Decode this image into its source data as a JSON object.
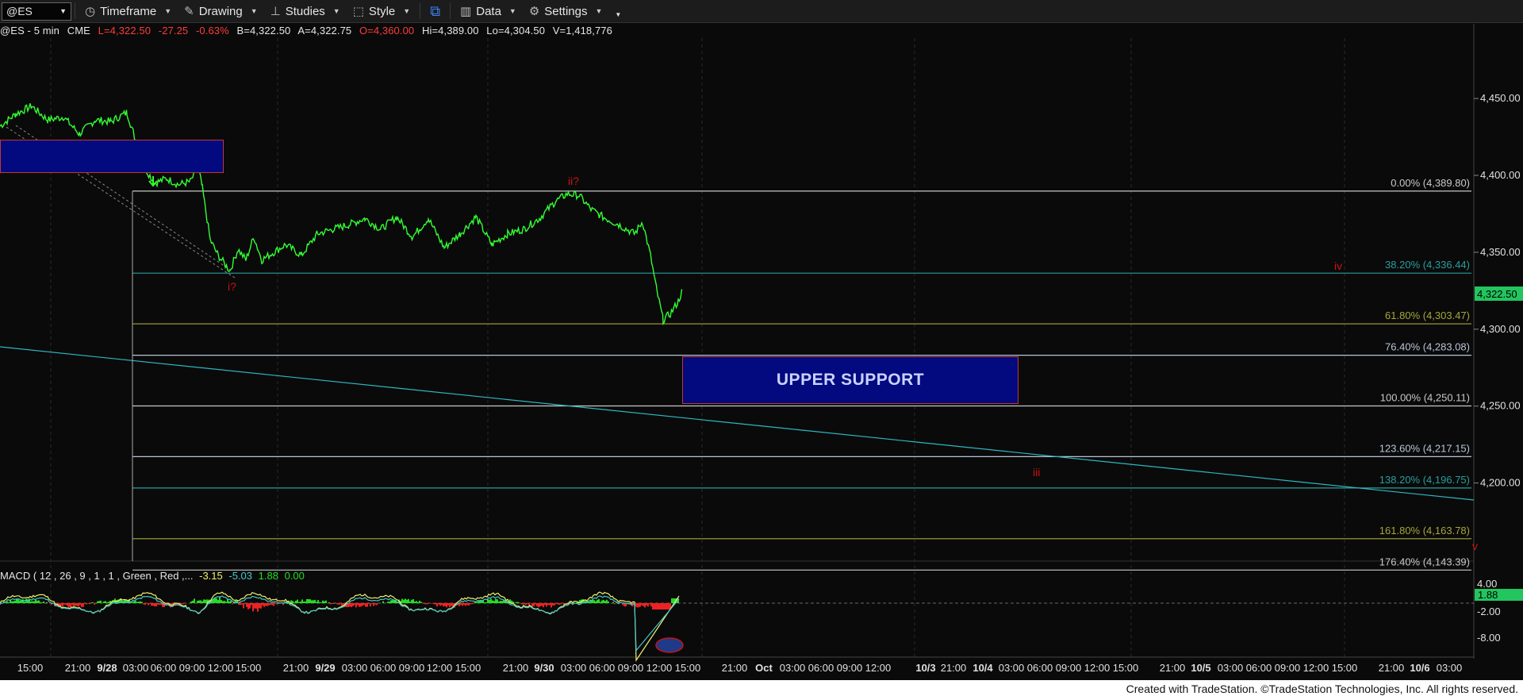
{
  "toolbar": {
    "symbol": "@ES",
    "items": [
      {
        "id": "timeframe",
        "label": "Timeframe",
        "icon": "clock-icon"
      },
      {
        "id": "drawing",
        "label": "Drawing",
        "icon": "pencil-icon"
      },
      {
        "id": "studies",
        "label": "Studies",
        "icon": "studies-icon"
      },
      {
        "id": "style",
        "label": "Style",
        "icon": "style-icon"
      },
      {
        "id": "data",
        "label": "Data",
        "icon": "data-icon"
      },
      {
        "id": "settings",
        "label": "Settings",
        "icon": "gear-icon"
      }
    ]
  },
  "quote": {
    "name": "@ES - 5 min",
    "exchange": "CME",
    "last": "L=4,322.50",
    "change": "-27.25",
    "pct": "-0.63%",
    "bid": "B=4,322.50",
    "ask": "A=4,322.75",
    "open": "O=4,360.00",
    "high": "Hi=4,389.00",
    "low": "Lo=4,304.50",
    "volume": "V=1,418,776"
  },
  "price_axis": {
    "ticks": [
      "4,450.00",
      "4,400.00",
      "4,350.00",
      "4,300.00",
      "4,250.00",
      "4,200.00"
    ],
    "last_price": "4,322.50",
    "last_price_color": "#22c55e"
  },
  "time_axis": {
    "labels": [
      "15:00",
      "21:00",
      "9/28",
      "03:00",
      "06:00",
      "09:00",
      "12:00",
      "15:00",
      "21:00",
      "9/29",
      "03:00",
      "06:00",
      "09:00",
      "12:00",
      "15:00",
      "21:00",
      "9/30",
      "03:00",
      "06:00",
      "09:00",
      "12:00",
      "15:00",
      "21:00",
      "Oct",
      "03:00",
      "06:00",
      "09:00",
      "12:00",
      "10/3",
      "21:00",
      "10/4",
      "03:00",
      "06:00",
      "09:00",
      "12:00",
      "15:00",
      "21:00",
      "10/5",
      "03:00",
      "06:00",
      "09:00",
      "12:00",
      "15:00",
      "21:00",
      "10/6",
      "03:00"
    ]
  },
  "fib_levels": [
    {
      "label": "0.00% (4,389.80)",
      "price": 4389.8,
      "color": "#c8c8c8"
    },
    {
      "label": "38.20% (4,336.44)",
      "price": 4336.44,
      "color": "#2a9d9d"
    },
    {
      "label": "61.80% (4,303.47)",
      "price": 4303.47,
      "color": "#a6a63a"
    },
    {
      "label": "76.40% (4,283.08)",
      "price": 4283.08,
      "color": "#b8c4d8"
    },
    {
      "label": "100.00% (4,250.11)",
      "price": 4250.11,
      "color": "#c8c8c8"
    },
    {
      "label": "123.60% (4,217.15)",
      "price": 4217.15,
      "color": "#b8c4d8"
    },
    {
      "label": "138.20% (4,196.75)",
      "price": 4196.75,
      "color": "#2a9d9d"
    },
    {
      "label": "161.80% (4,163.78)",
      "price": 4163.78,
      "color": "#a6a63a"
    },
    {
      "label": "176.40% (4,143.39)",
      "price": 4143.39,
      "color": "#c8c8c8"
    }
  ],
  "wave_labels": [
    "i?",
    "ii?",
    "iii",
    "iv",
    "v"
  ],
  "support_box": {
    "label": "UPPER SUPPORT"
  },
  "macd": {
    "title": "MACD ( 12 , 26 , 9 , 1 , 1 , Green , Red ,...",
    "v1": "-3.15",
    "v2": "-5.03",
    "v3": "1.88",
    "v4": "0.00",
    "ticks": [
      "4.00",
      "-2.00",
      "-8.00"
    ],
    "last": "1.88"
  },
  "colors": {
    "price_line": "#33ff33",
    "trend_line": "#2fb6c0",
    "wave": "#d01010",
    "macd_pos": "#22dd22",
    "macd_neg": "#ee2222"
  },
  "footer": "Created with TradeStation. ©TradeStation Technologies, Inc. All rights reserved."
}
